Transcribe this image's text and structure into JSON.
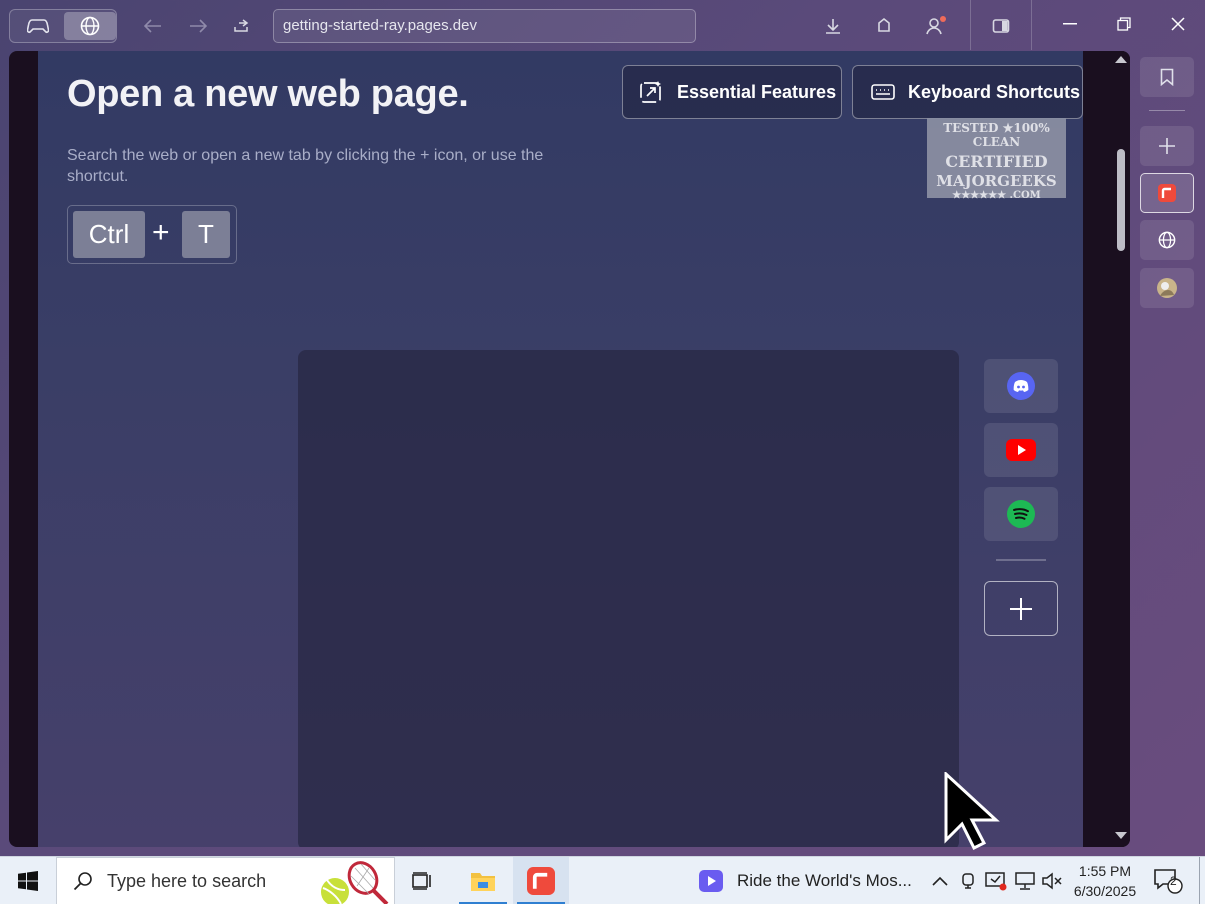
{
  "browser": {
    "url": "getting-started-ray.pages.dev",
    "mode_buttons": [
      "gamepad-icon",
      "globe-icon"
    ]
  },
  "page": {
    "heading": "Open a new web page.",
    "description": "Search the web or open a new tab by clicking the + icon, or use the shortcut.",
    "shortcut": {
      "key1": "Ctrl",
      "plus": "+",
      "key2": "T"
    },
    "buttons": {
      "features": "Essential Features",
      "shortcuts": "Keyboard Shortcuts"
    },
    "watermark": {
      "line1": "TESTED ★100% CLEAN",
      "line2": "CERTIFIED",
      "line3": "MAJORGEEKS",
      "line4": "★★★★★★ .COM"
    },
    "dock": [
      "discord-icon",
      "youtube-icon",
      "spotify-icon"
    ]
  },
  "sidebar": [
    "bookmark-icon",
    "plus-icon",
    "app-tab-icon",
    "globe-icon",
    "avatar-icon"
  ],
  "taskbar": {
    "search_placeholder": "Type here to search",
    "media_title": "Ride the World's Mos...",
    "time": "1:55 PM",
    "date": "6/30/2025",
    "notification_count": "2"
  },
  "colors": {
    "accent_red": "#ef4a3c",
    "discord": "#5865f2",
    "youtube": "#ff0000",
    "spotify": "#1db954"
  }
}
